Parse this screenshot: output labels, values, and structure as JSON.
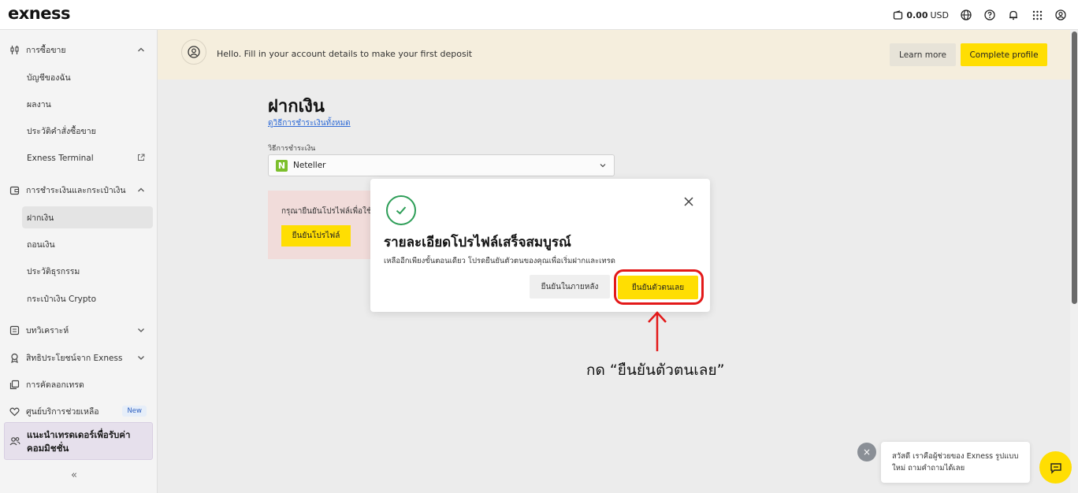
{
  "topbar": {
    "logo": "exness",
    "balance_amount": "0.00",
    "balance_currency": "USD"
  },
  "sidebar": {
    "sections": [
      {
        "label": "การซื้อขาย",
        "icon": "trading-icon"
      },
      {
        "label": "การชำระเงินและกระเป๋าเงิน",
        "icon": "wallet-icon"
      },
      {
        "label": "บทวิเคราะห์",
        "icon": "analytics-icon"
      },
      {
        "label": "สิทธิประโยชน์จาก Exness",
        "icon": "benefits-icon"
      },
      {
        "label": "การคัดลอกเทรด",
        "icon": "copy-trading-icon"
      },
      {
        "label": "ศูนย์บริการช่วยเหลือ",
        "icon": "help-center-icon"
      }
    ],
    "trading_items": [
      "บัญชีของฉัน",
      "ผลงาน",
      "ประวัติคำสั่งซื้อขาย",
      "Exness Terminal"
    ],
    "payment_items": [
      "ฝากเงิน",
      "ถอนเงิน",
      "ประวัติธุรกรรม",
      "กระเป๋าเงิน Crypto"
    ],
    "new_badge": "New",
    "referral": "แนะนำเทรดเดอร์เพื่อรับค่าคอมมิชชั่น",
    "collapse": "«"
  },
  "banner": {
    "message": "Hello. Fill in your account details to make your first deposit",
    "learn_more": "Learn more",
    "complete_profile": "Complete profile"
  },
  "deposit": {
    "title": "ฝากเงิน",
    "all_methods_link": "ดูวิธีการชำระเงินทั้งหมด",
    "method_label": "วิธีการชำระเงิน",
    "method_value": "Neteller",
    "method_logo": "N",
    "warning_text": "กรุณายืนยันโปรไฟล์เพื่อใช้",
    "verify_profile_button": "ยืนยันโปรไฟล์"
  },
  "modal": {
    "title": "รายละเอียดโปรไฟล์เสร็จสมบูรณ์",
    "description": "เหลืออีกเพียงขั้นตอนเดียว โปรดยืนยันตัวตนของคุณเพื่อเริ่มฝากและเทรด",
    "later_button": "ยืนยันในภายหลัง",
    "verify_button": "ยืนยันตัวตนเลย",
    "accent": "#ffde02",
    "success_color": "#2e9e58"
  },
  "annotation": {
    "text": "กด “ยืนยันตัวตนเลย”",
    "color": "#e31919"
  },
  "chat": {
    "message": "สวัสดี เราคือผู้ช่วยของ Exness รูปแบบใหม่ ถามคำถามได้เลย",
    "close": "×"
  }
}
